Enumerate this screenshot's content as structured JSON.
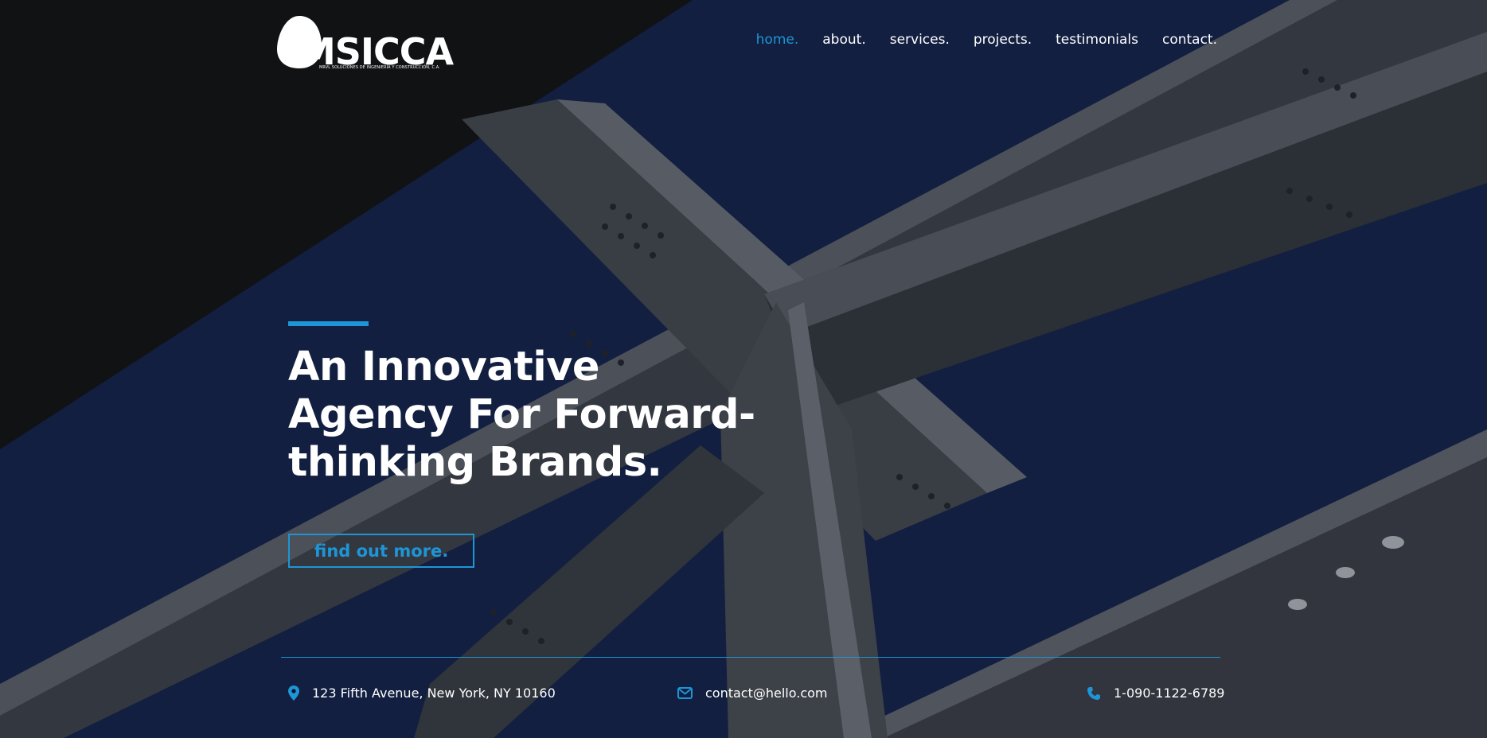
{
  "brand": {
    "logo_text": "MSICCA",
    "logo_tagline": "MRVL SOLUCIONES DE INGENIERÍA Y CONSTRUCCIÓN, C.A."
  },
  "nav": {
    "items": [
      {
        "label": "home."
      },
      {
        "label": "about."
      },
      {
        "label": "services."
      },
      {
        "label": "projects."
      },
      {
        "label": "testimonials"
      },
      {
        "label": "contact."
      }
    ],
    "active_index": 0
  },
  "hero": {
    "headline_line1": "An Innovative",
    "headline_line2": "Agency For Forward-",
    "headline_line3": "thinking Brands.",
    "cta_label": "find out more."
  },
  "contact": {
    "address": "123 Fifth Avenue, New York, NY 10160",
    "email": "contact@hello.com",
    "phone": "1-090-1122-6789"
  },
  "colors": {
    "accent": "#1e95d6",
    "sky": "#15244a",
    "beam": "#4c5058",
    "shadow": "#111214"
  },
  "icons": [
    "map-pin-icon",
    "envelope-icon",
    "phone-icon"
  ]
}
